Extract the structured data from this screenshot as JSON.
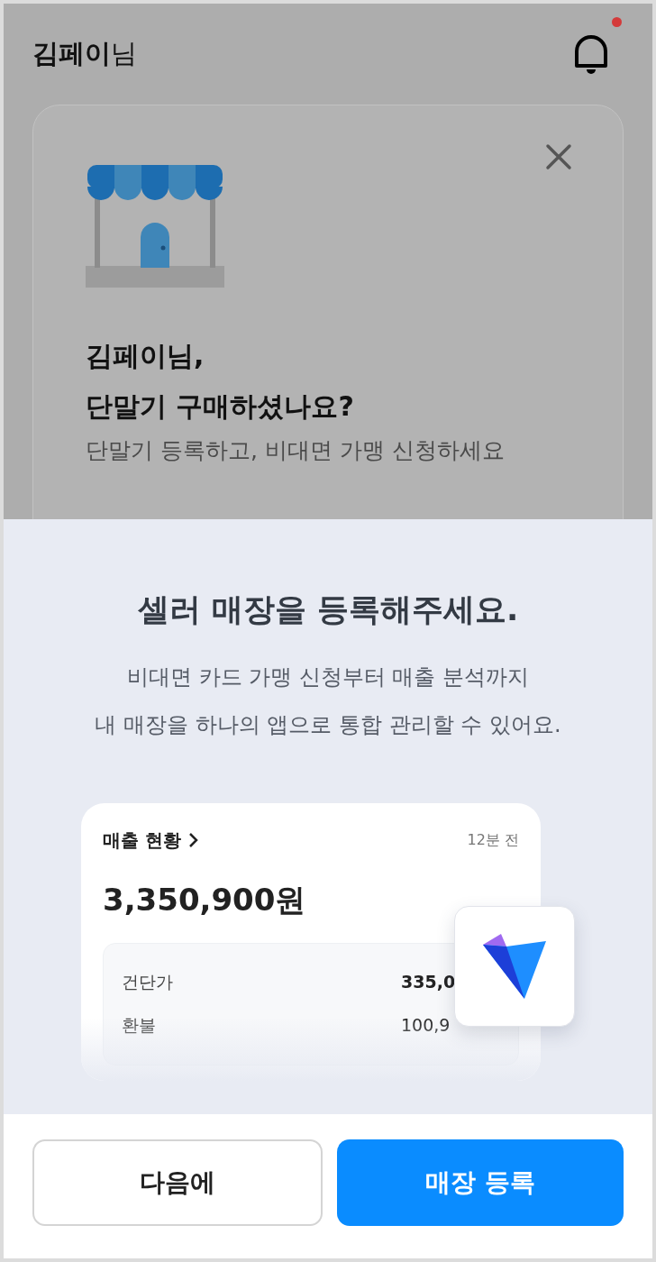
{
  "header": {
    "title": "**김페이**님",
    "notification_badge": true
  },
  "banner": {
    "title_lines": [
      "김페이님,",
      "단말기 구매하셨나요?"
    ],
    "subtitle": "단말기 등록하고, 비대면 가맹 신청하세요"
  },
  "sheet": {
    "title": "셀러 매장을 등록해주세요.",
    "description_lines": [
      "비대면 카드 가맹 신청부터 매출 분석까지",
      "내 매장을 하나의 앱으로 통합 관리할 수 있어요."
    ],
    "preview": {
      "heading": "매출 현황",
      "time": "12분 전",
      "amount": "3,350,900원",
      "rows": [
        {
          "label": "건단가",
          "value": "335,0",
          "bold": true
        },
        {
          "label": "환불",
          "value": "100,9",
          "bold": false
        }
      ]
    }
  },
  "buttons": [
    {
      "label": "다음에",
      "kind": "secondary"
    },
    {
      "label": "매장 등록",
      "kind": "primary"
    }
  ]
}
